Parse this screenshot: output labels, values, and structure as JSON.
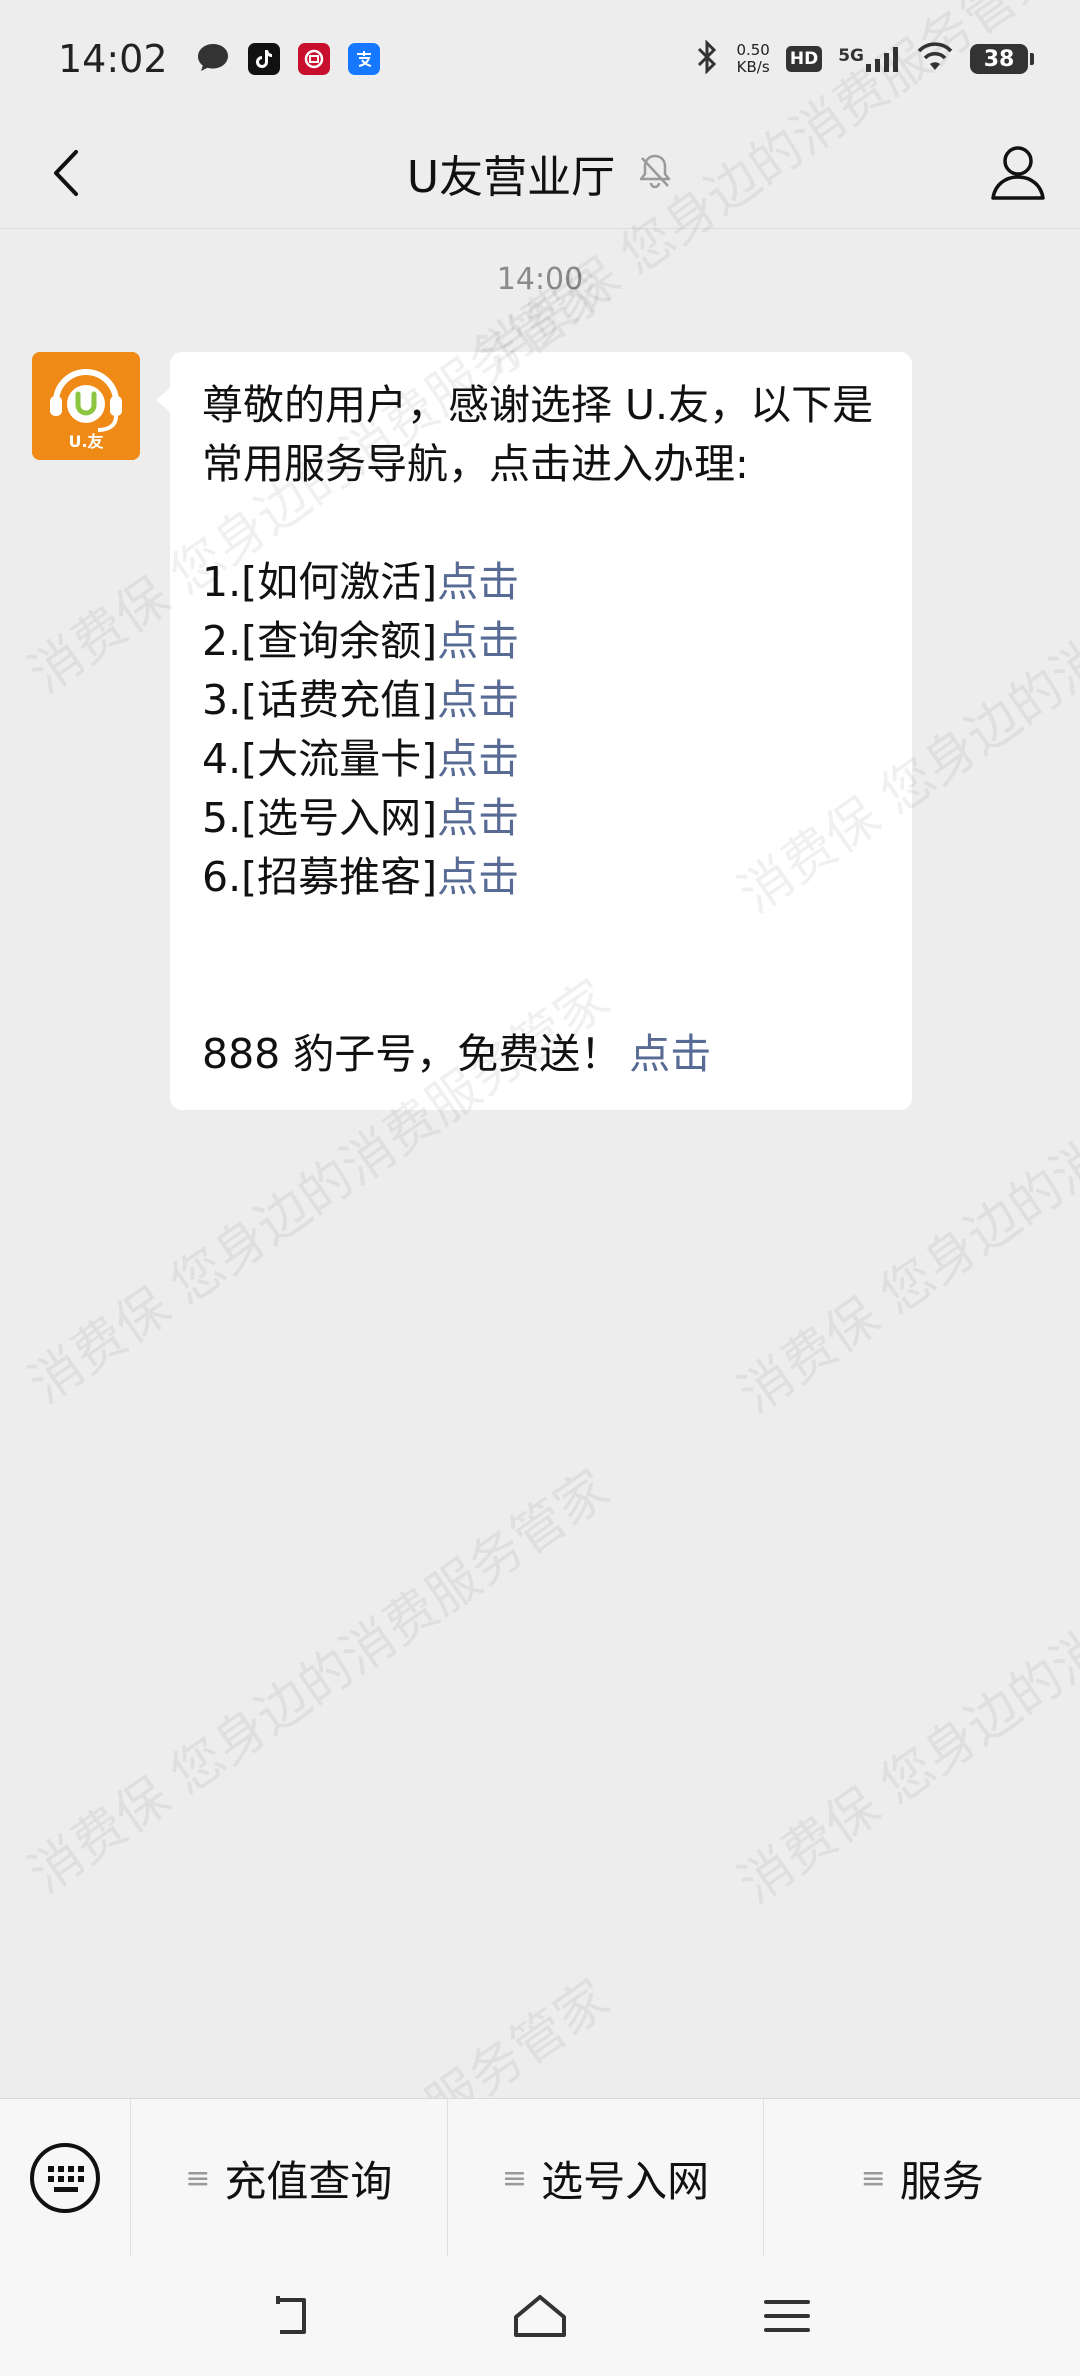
{
  "status_bar": {
    "time": "14:02",
    "speed_value": "0.50",
    "speed_unit": "KB/s",
    "hd": "HD",
    "network": "5G",
    "battery": "38",
    "app_icons": [
      "message-icon",
      "tiktok-icon",
      "bank-icon",
      "alipay-icon"
    ]
  },
  "header": {
    "title": "U友营业厅",
    "mute_icon": "bell-muted-icon"
  },
  "chat": {
    "timestamp": "14:00",
    "avatar_label": "U.友",
    "message": {
      "intro": "尊敬的用户，感谢选择 U.友，以下是常用服务导航，点击进入办理:",
      "items": [
        {
          "text": "1.[如何激活]",
          "link": "点击"
        },
        {
          "text": "2.[查询余额]",
          "link": "点击"
        },
        {
          "text": "3.[话费充值]",
          "link": "点击"
        },
        {
          "text": "4.[大流量卡]",
          "link": "点击"
        },
        {
          "text": "5.[选号入网]",
          "link": "点击"
        },
        {
          "text": "6.[招募推客]",
          "link": "点击"
        }
      ],
      "promo_text": "888 豹子号，免费送！",
      "promo_link": "点击"
    }
  },
  "watermark": {
    "text1": "消费保 您身边的消费服务管家"
  },
  "menu": {
    "items": [
      {
        "label": "充值查询"
      },
      {
        "label": "选号入网"
      },
      {
        "label": "服务"
      }
    ]
  },
  "colors": {
    "link": "#576b95",
    "background": "#ededed",
    "avatar": "#f08a16"
  }
}
